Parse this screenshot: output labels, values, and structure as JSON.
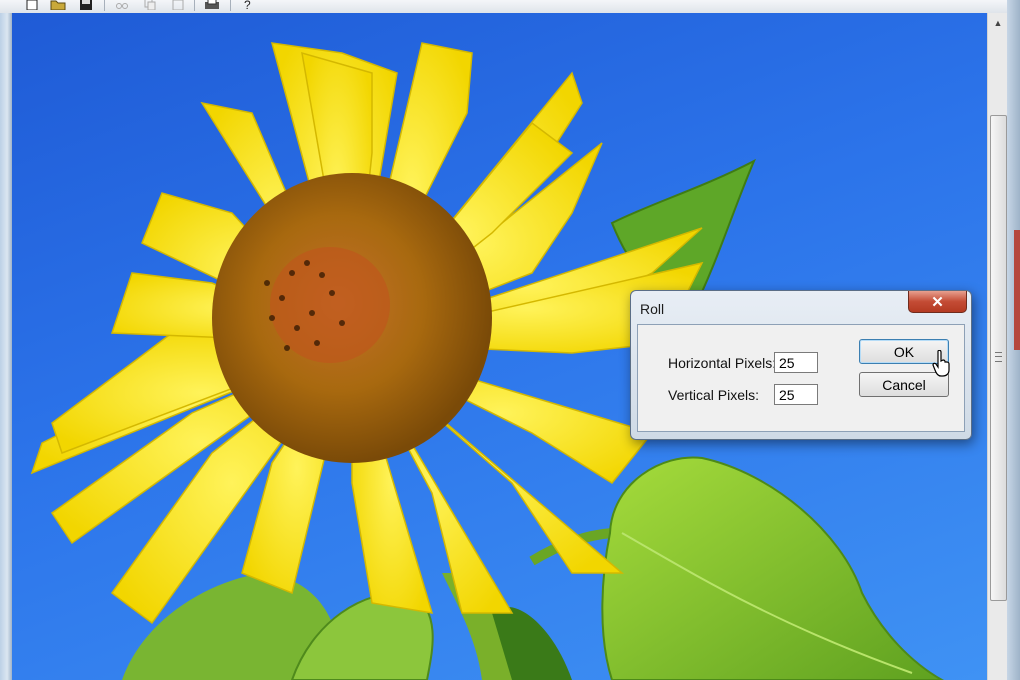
{
  "toolbar": {
    "buttons": [
      {
        "icon": "new-file-icon",
        "enabled": true
      },
      {
        "icon": "open-folder-icon",
        "enabled": true
      },
      {
        "icon": "save-disk-icon",
        "enabled": true
      },
      {
        "icon": "cut-scissors-icon",
        "enabled": false
      },
      {
        "icon": "copy-icon",
        "enabled": false
      },
      {
        "icon": "paste-icon",
        "enabled": false
      },
      {
        "icon": "print-icon",
        "enabled": true
      },
      {
        "icon": "help-icon",
        "enabled": true
      }
    ]
  },
  "canvas": {
    "image_subject": "sunflower-photo",
    "colors": {
      "sky": "#2c74ea",
      "petal": "#f4e10a",
      "center": "#a8690f",
      "leaf": "#7cc22c"
    }
  },
  "dialog": {
    "title": "Roll",
    "close_label": "✕",
    "horizontal_label": "Horizontal Pixels:",
    "horizontal_value": "25",
    "vertical_label": "Vertical Pixels:",
    "vertical_value": "25",
    "ok_label": "OK",
    "cancel_label": "Cancel"
  },
  "scrollbar": {
    "up_arrow": "▲"
  }
}
